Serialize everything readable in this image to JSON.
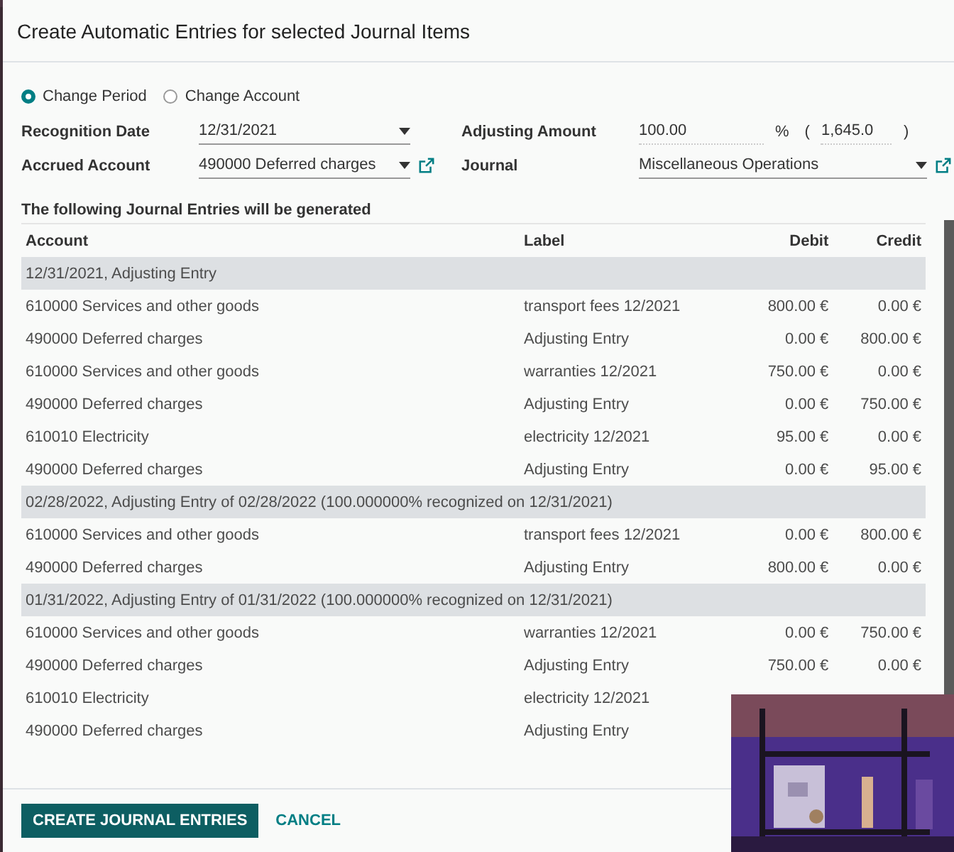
{
  "dialog": {
    "title": "Create Automatic Entries for selected Journal Items"
  },
  "action_options": [
    {
      "label": "Change Period",
      "selected": true
    },
    {
      "label": "Change Account",
      "selected": false
    }
  ],
  "form": {
    "recognition_date": {
      "label": "Recognition Date",
      "value": "12/31/2021"
    },
    "accrued_account": {
      "label": "Accrued Account",
      "value": "490000 Deferred charges"
    },
    "adjusting_amount": {
      "label": "Adjusting Amount",
      "value": "100.00",
      "unit": "%",
      "open": "(",
      "total": "1,645.0",
      "close": ")"
    },
    "journal": {
      "label": "Journal",
      "value": "Miscellaneous Operations"
    }
  },
  "preview": {
    "title": "The following Journal Entries will be generated",
    "columns": [
      "Account",
      "Label",
      "Debit",
      "Credit"
    ],
    "rows": [
      {
        "kind": "group",
        "text": "12/31/2021, Adjusting Entry"
      },
      {
        "kind": "line",
        "account": "610000 Services and other goods",
        "label": "transport fees 12/2021",
        "debit": "800.00 €",
        "credit": "0.00 €"
      },
      {
        "kind": "line",
        "account": "490000 Deferred charges",
        "label": "Adjusting Entry",
        "debit": "0.00 €",
        "credit": "800.00 €"
      },
      {
        "kind": "line",
        "account": "610000 Services and other goods",
        "label": "warranties 12/2021",
        "debit": "750.00 €",
        "credit": "0.00 €"
      },
      {
        "kind": "line",
        "account": "490000 Deferred charges",
        "label": "Adjusting Entry",
        "debit": "0.00 €",
        "credit": "750.00 €"
      },
      {
        "kind": "line",
        "account": "610010 Electricity",
        "label": "electricity 12/2021",
        "debit": "95.00 €",
        "credit": "0.00 €"
      },
      {
        "kind": "line",
        "account": "490000 Deferred charges",
        "label": "Adjusting Entry",
        "debit": "0.00 €",
        "credit": "95.00 €"
      },
      {
        "kind": "group",
        "text": "02/28/2022, Adjusting Entry of 02/28/2022 (100.000000% recognized on 12/31/2021)"
      },
      {
        "kind": "line",
        "account": "610000 Services and other goods",
        "label": "transport fees 12/2021",
        "debit": "0.00 €",
        "credit": "800.00 €"
      },
      {
        "kind": "line",
        "account": "490000 Deferred charges",
        "label": "Adjusting Entry",
        "debit": "800.00 €",
        "credit": "0.00 €"
      },
      {
        "kind": "group",
        "text": "01/31/2022, Adjusting Entry of 01/31/2022 (100.000000% recognized on 12/31/2021)"
      },
      {
        "kind": "line",
        "account": "610000 Services and other goods",
        "label": "warranties 12/2021",
        "debit": "0.00 €",
        "credit": "750.00 €"
      },
      {
        "kind": "line",
        "account": "490000 Deferred charges",
        "label": "Adjusting Entry",
        "debit": "750.00 €",
        "credit": "0.00 €"
      },
      {
        "kind": "line",
        "account": "610010 Electricity",
        "label": "electricity 12/2021"
      },
      {
        "kind": "line",
        "account": "490000 Deferred charges",
        "label": "Adjusting Entry"
      }
    ]
  },
  "buttons": [
    {
      "kind": "primary",
      "label": "CREATE JOURNAL ENTRIES"
    },
    {
      "kind": "link",
      "label": "CANCEL"
    }
  ]
}
